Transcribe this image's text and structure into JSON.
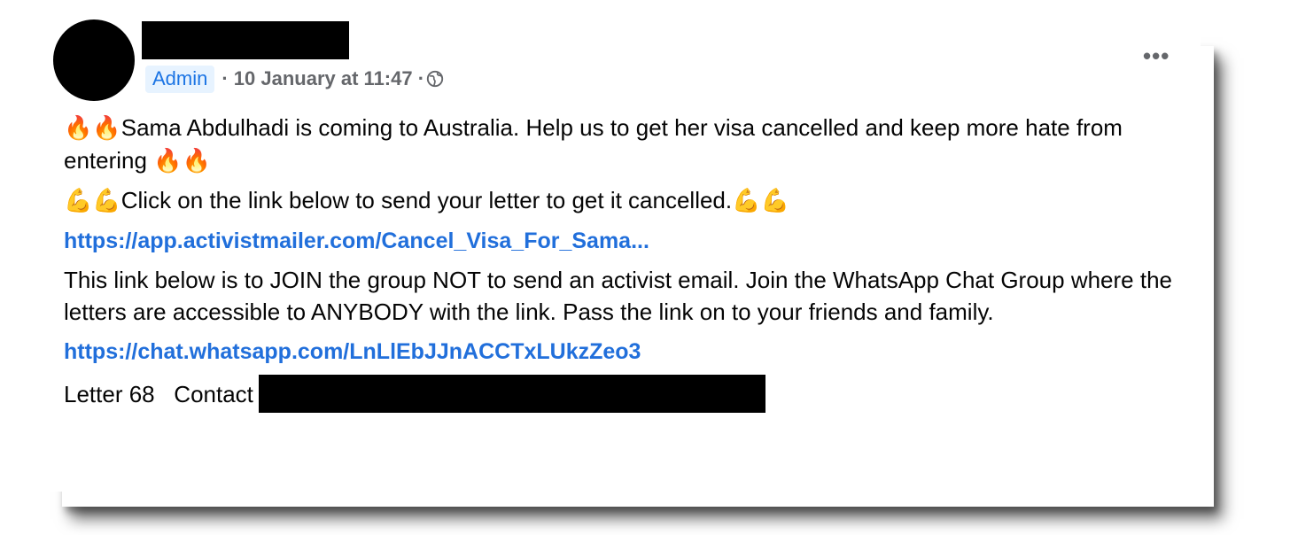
{
  "post": {
    "role_badge": "Admin",
    "timestamp": "· 10 January at 11:47 ·",
    "more_label": "•••",
    "paragraph1_emoji_lead": "🔥🔥",
    "paragraph1_text": "Sama Abdulhadi is coming to Australia. Help us to get her visa cancelled and keep more hate from entering ",
    "paragraph1_emoji_trail": "🔥🔥",
    "paragraph2_emoji_lead": "💪💪",
    "paragraph2_text": "Click on the link below to send your letter to get it cancelled.",
    "paragraph2_emoji_trail": "💪💪",
    "link1": "https://app.activistmailer.com/Cancel_Visa_For_Sama...",
    "paragraph3_text": "This link below  is to JOIN the group NOT to send an activist email. Join the WhatsApp Chat Group where the letters are accessible to ANYBODY with the link. Pass the link on to your friends and family.",
    "link2": "https://chat.whatsapp.com/LnLlEbJJnACCTxLUkzZeo3",
    "footer_text": "Letter 68   Contact"
  },
  "icons": {
    "globe": "globe-icon",
    "more": "more-options-icon",
    "fire": "fire-emoji",
    "muscle": "flexed-biceps-emoji"
  },
  "colors": {
    "link": "#216fdb",
    "badge_bg": "#e7f3ff",
    "badge_text": "#1b74e4",
    "meta_text": "#65676b",
    "body_text": "#050505"
  }
}
